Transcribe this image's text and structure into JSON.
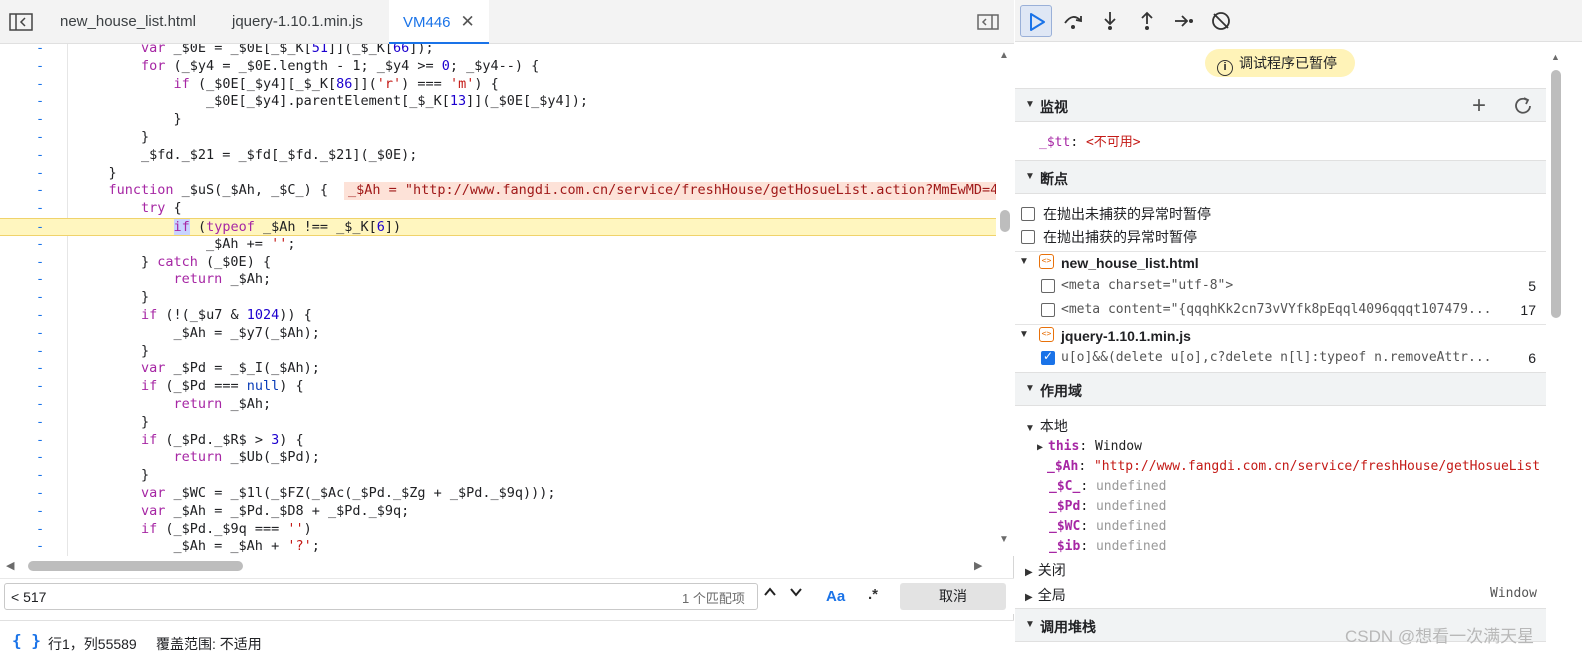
{
  "tabs": [
    {
      "label": "new_house_list.html"
    },
    {
      "label": "jquery-1.10.1.min.js"
    },
    {
      "label": "VM446",
      "close": "✕"
    }
  ],
  "code_lines": [
    {
      "dash": "-",
      "text": "        var _$0E = _$0E[_$_K[51]](_$_K[66]);"
    },
    {
      "dash": "-",
      "text": "        for (_$y4 = _$0E.length - 1; _$y4 >= 0; _$y4--) {"
    },
    {
      "dash": "-",
      "text": "            if (_$0E[_$y4][_$_K[86]]('r') === 'm') {"
    },
    {
      "dash": "-",
      "text": "                _$0E[_$y4].parentElement[_$_K[13]](_$0E[_$y4]);"
    },
    {
      "dash": "-",
      "text": "            }"
    },
    {
      "dash": "-",
      "text": "        }"
    },
    {
      "dash": "-",
      "text": "        _$fd._$21 = _$fd[_$fd._$21](_$0E);"
    },
    {
      "dash": "-",
      "text": "    }"
    },
    {
      "dash": "-",
      "text": "    function _$uS(_$Ah, _$C_) {"
    },
    {
      "dash": "-",
      "text": "        try {"
    },
    {
      "dash": "-",
      "text": "            if (typeof _$Ah !== _$_K[6])"
    },
    {
      "dash": "-",
      "text": "                _$Ah += '';"
    },
    {
      "dash": "-",
      "text": "        } catch (_$0E) {"
    },
    {
      "dash": "-",
      "text": "            return _$Ah;"
    },
    {
      "dash": "-",
      "text": "        }"
    },
    {
      "dash": "-",
      "text": "        if (!(_$u7 & 1024)) {"
    },
    {
      "dash": "-",
      "text": "            _$Ah = _$y7(_$Ah);"
    },
    {
      "dash": "-",
      "text": "        }"
    },
    {
      "dash": "-",
      "text": "        var _$Pd = _$_I(_$Ah);"
    },
    {
      "dash": "-",
      "text": "        if (_$Pd === null) {"
    },
    {
      "dash": "-",
      "text": "            return _$Ah;"
    },
    {
      "dash": "-",
      "text": "        }"
    },
    {
      "dash": "-",
      "text": "        if (_$Pd._$R$ > 3) {"
    },
    {
      "dash": "-",
      "text": "            return _$Ub(_$Pd);"
    },
    {
      "dash": "-",
      "text": "        }"
    },
    {
      "dash": "-",
      "text": "        var _$WC = _$1l(_$FZ(_$Ac(_$Pd._$Zg + _$Pd._$9q)));"
    },
    {
      "dash": "-",
      "text": "        var _$Ah = _$Pd._$D8 + _$Pd._$9q;"
    },
    {
      "dash": "-",
      "text": "        if (_$Pd._$9q === '')"
    },
    {
      "dash": "-",
      "text": "            _$Ah = _$Ah + '?';"
    },
    {
      "dash": "-",
      "text": "        else"
    }
  ],
  "inline_value": "_$Ah = \"http://www.fangdi.com.cn/service/freshHouse/getHosueList.action?MmEwMD=4",
  "search": {
    "value": "< 517",
    "match_count": "1 个匹配项",
    "aa": "Aa",
    "regex": ".*",
    "cancel": "取消"
  },
  "status": {
    "braces": "{ }",
    "position": "行1，列55589",
    "coverage": "覆盖范围: 不适用"
  },
  "debugger": {
    "paused": "调试程序已暂停",
    "watch": {
      "title": "监视",
      "name": "_$tt",
      "sep": ": ",
      "value": "<不可用>"
    },
    "breakpoints": {
      "title": "断点",
      "uncaught": "在抛出未捕获的异常时暂停",
      "caught": "在抛出捕获的异常时暂停",
      "files": [
        {
          "name": "new_house_list.html",
          "items": [
            {
              "code": "<meta charset=\"utf-8\">",
              "line": "5",
              "checked": false
            },
            {
              "code": "<meta content=\"{qqqhKk2cn73vVYfk8pEqql4096qqqt107479...",
              "line": "17",
              "checked": false
            }
          ]
        },
        {
          "name": "jquery-1.10.1.min.js",
          "items": [
            {
              "code": "u[o]&&(delete u[o],c?delete n[l]:typeof n.removeAttr...",
              "line": "6",
              "checked": true
            }
          ]
        }
      ]
    },
    "scope": {
      "title": "作用域",
      "local": "本地",
      "this_name": "this",
      "this_val": "Window",
      "vars": [
        {
          "name": "_$Ah",
          "value": "\"http://www.fangdi.com.cn/service/freshHouse/getHosueList",
          "kind": "str"
        },
        {
          "name": "_$C_",
          "value": "undefined",
          "kind": "und"
        },
        {
          "name": "_$Pd",
          "value": "undefined",
          "kind": "und"
        },
        {
          "name": "_$WC",
          "value": "undefined",
          "kind": "und"
        },
        {
          "name": "_$ib",
          "value": "undefined",
          "kind": "und"
        }
      ],
      "closure": "关闭",
      "global": "全局",
      "global_val": "Window"
    },
    "callstack": "调用堆栈"
  },
  "watermark": "CSDN @想看一次满天星"
}
